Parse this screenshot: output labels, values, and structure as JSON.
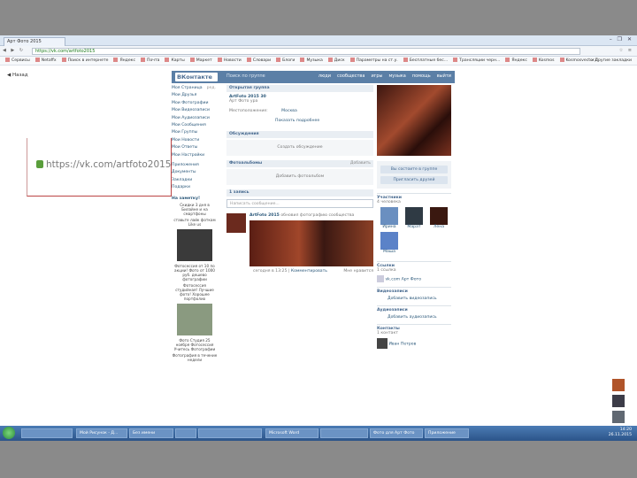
{
  "browser": {
    "tab_title": "Арт Фото 2015",
    "window_controls": "–  ❐  ✕",
    "nav": "◀ ▶ ↻",
    "url": "https://vk.com/artfoto2015",
    "tools": "☆ ≡",
    "bookmarks": [
      "Сервисы",
      "Netaffx",
      "Поиск в интернете",
      "Яндекс",
      "Почта",
      "Карты",
      "Маркет",
      "Новости",
      "Словари",
      "Блоги",
      "Музыка",
      "Диск",
      "Параметры на ст.у.",
      "Бесплатные бес...",
      "Трансляции черн...",
      "Яндекс",
      "Kosmos",
      "Kosmosvector.c"
    ],
    "bookmarks_right": "» Другие закладки"
  },
  "left_extra": {
    "back": "◀ Назад",
    "zoom_url": "https://vk.com/artfoto2015"
  },
  "vk": {
    "logo": "ВКонтакте",
    "search": "Поиск по группе",
    "topnav": [
      "люди",
      "сообщества",
      "игры",
      "музыка",
      "помощь",
      "выйти"
    ],
    "left_menu": [
      "Моя Страница",
      "Мои Друзья",
      "Мои Фотографии",
      "Мои Видеозаписи",
      "Мои Аудиозаписи",
      "Мои Сообщения",
      "Мои Группы",
      "Мои Новости",
      "Мои Ответы",
      "Мои Настройки"
    ],
    "left_menu_edit": "ред.",
    "left_menu2": [
      "Приложения",
      "Документы",
      "Закладки",
      "Подарки"
    ],
    "ads_title": "На заметку!",
    "ads": [
      "Скидки 3 дня в Билайне и на смартфоны",
      "ставьте лайк фоткам Like us",
      "Фотосессия от 10 по акции! Фото от 1000 руб. дешево фотографии",
      "Фотосессия студийная! Лучшие фото! Хорошее портфолио",
      "Фото Студия 25 ноября Фотосессия Учитесь Фотографии",
      "Фотография в течение недели"
    ],
    "center": {
      "group_info_title": "Открытая группа",
      "group_name": "ArtFoto 2015 30",
      "status": "Арт Фото ура",
      "field_label": "Местоположение:",
      "field_value": "Москва",
      "more": "Показать подробнее",
      "discussions_title": "Обсуждения",
      "discussions_btn": "Создать обсуждение",
      "photos_title": "Фотоальбомы",
      "photos_count": "Добавить",
      "photos_btn": "Добавить фотоальбом",
      "wall_title": "1 запись",
      "wall_placeholder": "Написать сообщение...",
      "post_author": "ArtFoto 2015",
      "post_text": "обновил фотографию сообщества",
      "post_date": "сегодня в 13:25",
      "post_comment": "Комментировать",
      "post_like": "Мне нравится"
    },
    "right": {
      "join_btn": "Вы состоите в группе",
      "invite_btn": "Пригласить друзей",
      "members_title": "Участники",
      "members_count": "4 человека",
      "members": [
        "Ирина",
        "Марат",
        "Лена",
        "Маша"
      ],
      "links_title": "Ссылки",
      "links_count": "1 ссылка",
      "link_name": "vk.com Арт Фото",
      "videos_title": "Видеозаписи",
      "videos_btn": "Добавить видеозапись",
      "audio_title": "Аудиозаписи",
      "audio_btn": "Добавить аудиозапись",
      "contacts_title": "Контакты",
      "contacts_count": "1 контакт",
      "contact_name": "Иван Петров"
    }
  },
  "taskbar": {
    "items": [
      "",
      "Мой Рисунок - Д...",
      "Без имени",
      "",
      "",
      "Microsoft Word",
      "",
      "Фото для Арт Фото",
      "Приложение"
    ],
    "clock": "14:20",
    "date": "26.11.2015"
  }
}
